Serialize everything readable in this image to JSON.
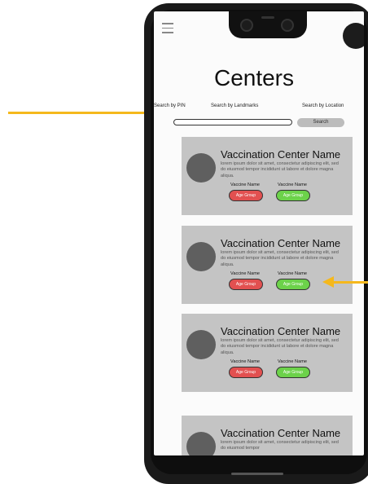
{
  "app": {
    "title": "Centers"
  },
  "search": {
    "tabs": [
      "Search by PIN",
      "Search by Landmarks",
      "Search by Location"
    ],
    "input_value": "",
    "button_label": "Search"
  },
  "centers": [
    {
      "name": "Vaccination Center Name",
      "description": "lorem ipsum dolor sit amet, consectetur adipiscing elit, sed do eiusmod tempor incididunt ut labore et dolore magna aliqua.",
      "vaccines": [
        {
          "name": "Vaccine Name",
          "age_group": "Age Group",
          "status_color": "#e25050"
        },
        {
          "name": "Vaccine Name",
          "age_group": "Age Group",
          "status_color": "#6cd24a"
        }
      ]
    },
    {
      "name": "Vaccination Center Name",
      "description": "lorem ipsum dolor sit amet, consectetur adipiscing elit, sed do eiusmod tempor incididunt ut labore et dolore magna aliqua.",
      "vaccines": [
        {
          "name": "Vaccine Name",
          "age_group": "Age Group",
          "status_color": "#e25050"
        },
        {
          "name": "Vaccine Name",
          "age_group": "Age Group",
          "status_color": "#6cd24a"
        }
      ]
    },
    {
      "name": "Vaccination Center Name",
      "description": "lorem ipsum dolor sit amet, consectetur adipiscing elit, sed do eiusmod tempor incididunt ut labore et dolore magna aliqua.",
      "vaccines": [
        {
          "name": "Vaccine Name",
          "age_group": "Age Group",
          "status_color": "#e25050"
        },
        {
          "name": "Vaccine Name",
          "age_group": "Age Group",
          "status_color": "#6cd24a"
        }
      ]
    },
    {
      "name": "Vaccination Center Name",
      "description": "lorem ipsum dolor sit amet, consectetur adipiscing elit, sed do eiusmod tempor",
      "vaccines": []
    }
  ],
  "icons": {
    "menu": "hamburger-menu-icon",
    "profile": "profile-avatar-icon",
    "camera": "camera-icon"
  },
  "colors": {
    "annotation_arrow": "#f5b81c",
    "card_background": "#c4c4c4",
    "age_group_red": "#e25050",
    "age_group_green": "#6cd24a"
  }
}
